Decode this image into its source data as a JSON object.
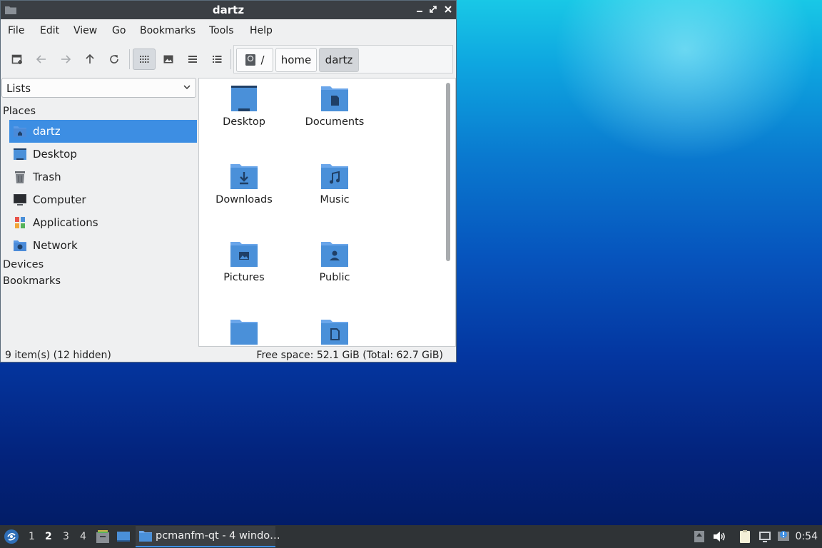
{
  "window": {
    "title": "dartz",
    "menu": [
      "File",
      "Edit",
      "View",
      "Go",
      "Bookmarks",
      "Tools",
      "Help"
    ]
  },
  "toolbar": {
    "buttons": [
      "new-tab-icon",
      "back-icon",
      "forward-icon",
      "up-icon",
      "reload-icon",
      "icon-view-icon",
      "thumbnail-view-icon",
      "compact-view-icon",
      "detailed-list-icon"
    ],
    "active_view": "icon-view-icon"
  },
  "path": {
    "crumbs": [
      "/",
      "home",
      "dartz"
    ],
    "current": "dartz"
  },
  "sidebar": {
    "mode": "Lists",
    "places_header": "Places",
    "places": [
      {
        "label": "dartz",
        "icon": "home-folder-icon",
        "selected": true
      },
      {
        "label": "Desktop",
        "icon": "desktop-icon"
      },
      {
        "label": "Trash",
        "icon": "trash-icon"
      },
      {
        "label": "Computer",
        "icon": "computer-icon"
      },
      {
        "label": "Applications",
        "icon": "applications-icon"
      },
      {
        "label": "Network",
        "icon": "network-icon"
      }
    ],
    "devices_header": "Devices",
    "bookmarks_header": "Bookmarks"
  },
  "files": [
    {
      "label": "Desktop",
      "icon": "desktop-folder-icon"
    },
    {
      "label": "Documents",
      "icon": "documents-folder-icon"
    },
    {
      "label": "Downloads",
      "icon": "downloads-folder-icon"
    },
    {
      "label": "Music",
      "icon": "music-folder-icon"
    },
    {
      "label": "Pictures",
      "icon": "pictures-folder-icon"
    },
    {
      "label": "Public",
      "icon": "public-folder-icon"
    },
    {
      "label": "",
      "icon": "folder-icon"
    },
    {
      "label": "",
      "icon": "templates-folder-icon"
    }
  ],
  "status": {
    "items": "9 item(s) (12 hidden)",
    "free_space": "Free space: 52.1 GiB (Total: 62.7 GiB)"
  },
  "taskbar": {
    "desktops": [
      "1",
      "2",
      "3",
      "4"
    ],
    "active_desktop": "2",
    "task_label": "pcmanfm-qt - 4 windo…",
    "clock": "0:54"
  },
  "colors": {
    "accent": "#3d8ee3",
    "folder": "#4a90d9",
    "titlebar": "#3b3f44",
    "taskbar": "#2f3336"
  }
}
